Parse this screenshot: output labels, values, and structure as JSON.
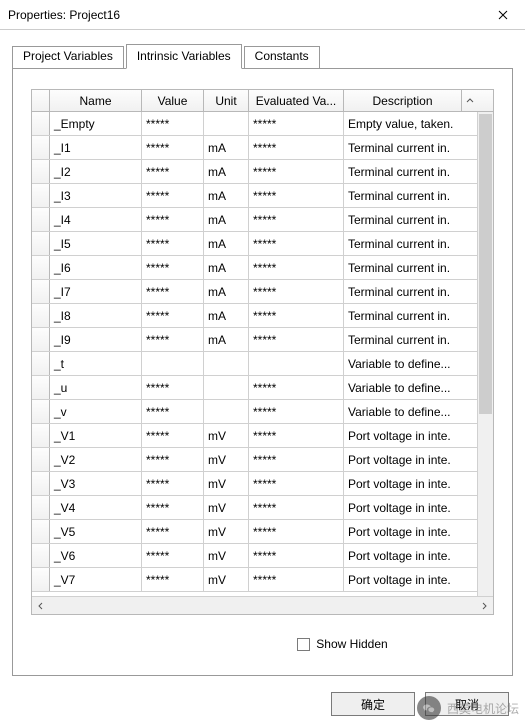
{
  "window": {
    "title": "Properties: Project16"
  },
  "tabs": {
    "items": [
      {
        "label": "Project Variables"
      },
      {
        "label": "Intrinsic Variables"
      },
      {
        "label": "Constants"
      }
    ],
    "active_index": 1
  },
  "grid": {
    "headers": {
      "name": "Name",
      "value": "Value",
      "unit": "Unit",
      "evaluated": "Evaluated Va...",
      "description": "Description"
    },
    "rows": [
      {
        "name": "_Empty",
        "value": "*****",
        "unit": "",
        "evaluated": "*****",
        "description": "Empty value, taken."
      },
      {
        "name": "_I1",
        "value": "*****",
        "unit": "mA",
        "evaluated": "*****",
        "description": "Terminal current in."
      },
      {
        "name": "_I2",
        "value": "*****",
        "unit": "mA",
        "evaluated": "*****",
        "description": "Terminal current in."
      },
      {
        "name": "_I3",
        "value": "*****",
        "unit": "mA",
        "evaluated": "*****",
        "description": "Terminal current in."
      },
      {
        "name": "_I4",
        "value": "*****",
        "unit": "mA",
        "evaluated": "*****",
        "description": "Terminal current in."
      },
      {
        "name": "_I5",
        "value": "*****",
        "unit": "mA",
        "evaluated": "*****",
        "description": "Terminal current in."
      },
      {
        "name": "_I6",
        "value": "*****",
        "unit": "mA",
        "evaluated": "*****",
        "description": "Terminal current in."
      },
      {
        "name": "_I7",
        "value": "*****",
        "unit": "mA",
        "evaluated": "*****",
        "description": "Terminal current in."
      },
      {
        "name": "_I8",
        "value": "*****",
        "unit": "mA",
        "evaluated": "*****",
        "description": "Terminal current in."
      },
      {
        "name": "_I9",
        "value": "*****",
        "unit": "mA",
        "evaluated": "*****",
        "description": "Terminal current in."
      },
      {
        "name": "_t",
        "value": "",
        "unit": "",
        "evaluated": "",
        "description": "Variable to define..."
      },
      {
        "name": "_u",
        "value": "*****",
        "unit": "",
        "evaluated": "*****",
        "description": "Variable to define..."
      },
      {
        "name": "_v",
        "value": "*****",
        "unit": "",
        "evaluated": "*****",
        "description": "Variable to define..."
      },
      {
        "name": "_V1",
        "value": "*****",
        "unit": "mV",
        "evaluated": "*****",
        "description": "Port voltage in inte."
      },
      {
        "name": "_V2",
        "value": "*****",
        "unit": "mV",
        "evaluated": "*****",
        "description": "Port voltage in inte."
      },
      {
        "name": "_V3",
        "value": "*****",
        "unit": "mV",
        "evaluated": "*****",
        "description": "Port voltage in inte."
      },
      {
        "name": "_V4",
        "value": "*****",
        "unit": "mV",
        "evaluated": "*****",
        "description": "Port voltage in inte."
      },
      {
        "name": "_V5",
        "value": "*****",
        "unit": "mV",
        "evaluated": "*****",
        "description": "Port voltage in inte."
      },
      {
        "name": "_V6",
        "value": "*****",
        "unit": "mV",
        "evaluated": "*****",
        "description": "Port voltage in inte."
      },
      {
        "name": "_V7",
        "value": "*****",
        "unit": "mV",
        "evaluated": "*****",
        "description": "Port voltage in inte."
      }
    ]
  },
  "options": {
    "show_hidden_label": "Show Hidden",
    "show_hidden_checked": false
  },
  "buttons": {
    "ok": "确定",
    "cancel": "取消"
  },
  "watermark": {
    "text": "西莫电机论坛"
  }
}
